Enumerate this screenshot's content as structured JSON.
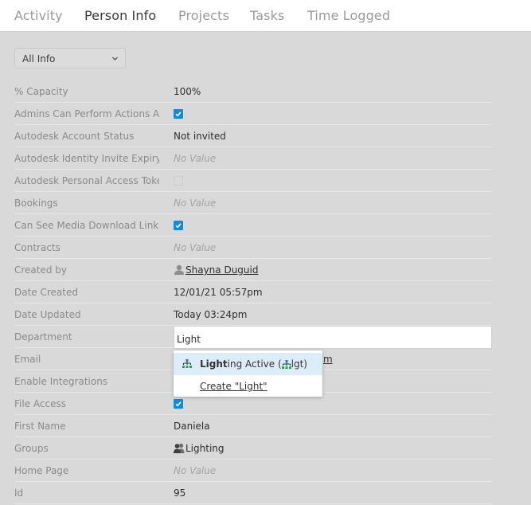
{
  "tabs": [
    {
      "label": "Activity",
      "active": false
    },
    {
      "label": "Person Info",
      "active": true
    },
    {
      "label": "Projects",
      "active": false
    },
    {
      "label": "Tasks",
      "active": false
    },
    {
      "label": "Time Logged",
      "active": false
    }
  ],
  "filter": {
    "selected": "All Info",
    "icon": "chevron-down-icon"
  },
  "fields": [
    {
      "label": "% Capacity",
      "type": "text",
      "value": "100%"
    },
    {
      "label": "Admins Can Perform Actions As",
      "type": "checkbox",
      "checked": true
    },
    {
      "label": "Autodesk Account Status",
      "type": "text",
      "value": "Not invited"
    },
    {
      "label": "Autodesk Identity Invite Expiry",
      "type": "empty",
      "value": "No Value"
    },
    {
      "label": "Autodesk Personal Access Token",
      "type": "checkbox",
      "checked": false
    },
    {
      "label": "Bookings",
      "type": "empty",
      "value": "No Value"
    },
    {
      "label": "Can See Media Download Links in",
      "type": "checkbox",
      "checked": true
    },
    {
      "label": "Contracts",
      "type": "empty",
      "value": "No Value"
    },
    {
      "label": "Created by",
      "type": "user-link",
      "value": "Shayna Duguid",
      "icon": "user-icon"
    },
    {
      "label": "Date Created",
      "type": "text",
      "value": "12/01/21 05:57pm"
    },
    {
      "label": "Date Updated",
      "type": "text",
      "value": "Today 03:24pm"
    },
    {
      "label": "Department",
      "type": "editing",
      "value": "Light"
    },
    {
      "label": "Email",
      "type": "obscured-link",
      "value": "m"
    },
    {
      "label": "Enable Integrations",
      "type": "obscured",
      "value": ""
    },
    {
      "label": "File Access",
      "type": "checkbox",
      "checked": true
    },
    {
      "label": "First Name",
      "type": "text",
      "value": "Daniela"
    },
    {
      "label": "Groups",
      "type": "group",
      "value": "Lighting",
      "icon": "group-icon"
    },
    {
      "label": "Home Page",
      "type": "empty",
      "value": "No Value"
    },
    {
      "label": "Id",
      "type": "text",
      "value": "95"
    }
  ],
  "autocomplete": {
    "suggestion": {
      "match": "Light",
      "rest": "ing Active (",
      "code": "lgt",
      "close": ")",
      "icon": "department-icon"
    },
    "create_label": "Create \"Light\""
  },
  "colors": {
    "checkbox": "#0d8be0",
    "highlight": "#dcecf8",
    "dept_icon_top": "#1f7ad1",
    "dept_icon_bottom": "#2ea44f"
  }
}
